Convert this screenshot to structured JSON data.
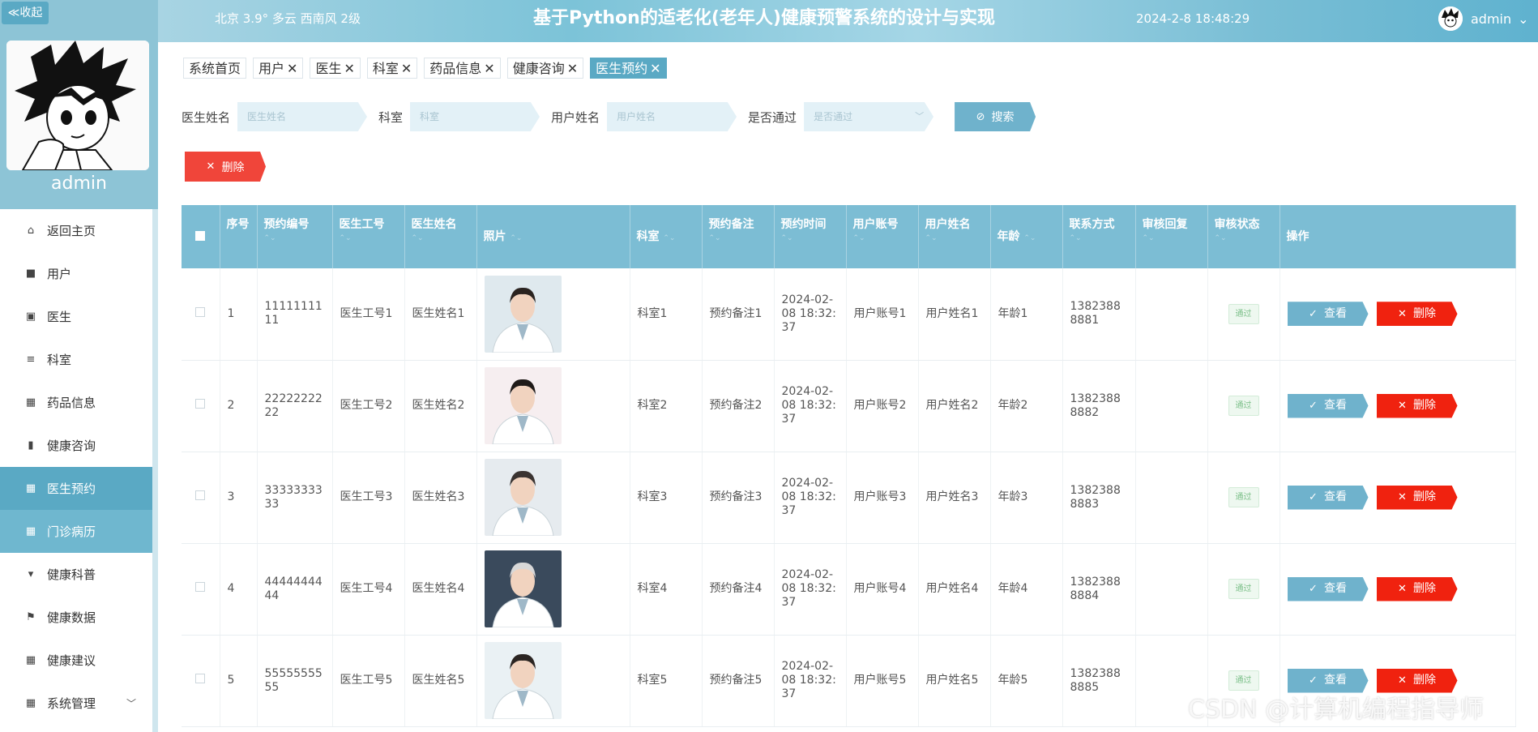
{
  "sidebar": {
    "collapse_label": "≪收起",
    "username": "admin",
    "menu": [
      {
        "label": "返回主页",
        "icon": "home-icon",
        "glyph": "⌂"
      },
      {
        "label": "用户",
        "icon": "user-icon",
        "glyph": "■"
      },
      {
        "label": "医生",
        "icon": "doctor-icon",
        "glyph": "▣"
      },
      {
        "label": "科室",
        "icon": "list-icon",
        "glyph": "≡"
      },
      {
        "label": "药品信息",
        "icon": "grid-icon",
        "glyph": "▦"
      },
      {
        "label": "健康咨询",
        "icon": "chart-icon",
        "glyph": "▮"
      },
      {
        "label": "医生预约",
        "icon": "grid-icon",
        "glyph": "▦"
      },
      {
        "label": "门诊病历",
        "icon": "grid-icon",
        "glyph": "▦"
      },
      {
        "label": "健康科普",
        "icon": "flag-icon",
        "glyph": "▾"
      },
      {
        "label": "健康数据",
        "icon": "flag-icon",
        "glyph": "⚑"
      },
      {
        "label": "健康建议",
        "icon": "grid-icon",
        "glyph": "▦"
      },
      {
        "label": "系统管理",
        "icon": "grid-icon",
        "glyph": "▦"
      }
    ]
  },
  "header": {
    "weather": "北京  3.9°  多云  西南风  2级",
    "title": "基于Python的适老化(老年人)健康预警系统的设计与实现",
    "datetime": "2024-2-8 18:48:29",
    "user": "admin",
    "user_chevron": "⌄"
  },
  "tabs": [
    {
      "label": "系统首页",
      "closable": false
    },
    {
      "label": "用户",
      "closable": true
    },
    {
      "label": "医生",
      "closable": true
    },
    {
      "label": "科室",
      "closable": true
    },
    {
      "label": "药品信息",
      "closable": true
    },
    {
      "label": "健康咨询",
      "closable": true
    },
    {
      "label": "医生预约",
      "closable": true,
      "active": true
    }
  ],
  "search": {
    "doctor_name_label": "医生姓名",
    "doctor_name_placeholder": "医生姓名",
    "dept_label": "科室",
    "dept_placeholder": "科室",
    "user_name_label": "用户姓名",
    "user_name_placeholder": "用户姓名",
    "passed_label": "是否通过",
    "passed_placeholder": "是否通过",
    "search_label": "搜索",
    "search_glyph": "⊘"
  },
  "delete_label": "删除",
  "delete_glyph": "✕",
  "table": {
    "headers": [
      "序号",
      "预约编号",
      "医生工号",
      "医生姓名",
      "照片",
      "科室",
      "预约备注",
      "预约时间",
      "用户账号",
      "用户姓名",
      "年龄",
      "联系方式",
      "审核回复",
      "审核状态",
      "操作"
    ],
    "sort_glyph": "⌃⌄",
    "rows": [
      {
        "idx": "1",
        "code": "1111111111",
        "doc_no": "医生工号1",
        "doc_name": "医生姓名1",
        "dept": "科室1",
        "note": "预约备注1",
        "time": "2024-02-08 18:32:37",
        "account": "用户账号1",
        "uname": "用户姓名1",
        "age": "年龄1",
        "phone": "13823888881",
        "reply": "",
        "status": "通过"
      },
      {
        "idx": "2",
        "code": "2222222222",
        "doc_no": "医生工号2",
        "doc_name": "医生姓名2",
        "dept": "科室2",
        "note": "预约备注2",
        "time": "2024-02-08 18:32:37",
        "account": "用户账号2",
        "uname": "用户姓名2",
        "age": "年龄2",
        "phone": "13823888882",
        "reply": "",
        "status": "通过"
      },
      {
        "idx": "3",
        "code": "3333333333",
        "doc_no": "医生工号3",
        "doc_name": "医生姓名3",
        "dept": "科室3",
        "note": "预约备注3",
        "time": "2024-02-08 18:32:37",
        "account": "用户账号3",
        "uname": "用户姓名3",
        "age": "年龄3",
        "phone": "13823888883",
        "reply": "",
        "status": "通过"
      },
      {
        "idx": "4",
        "code": "4444444444",
        "doc_no": "医生工号4",
        "doc_name": "医生姓名4",
        "dept": "科室4",
        "note": "预约备注4",
        "time": "2024-02-08 18:32:37",
        "account": "用户账号4",
        "uname": "用户姓名4",
        "age": "年龄4",
        "phone": "13823888884",
        "reply": "",
        "status": "通过"
      },
      {
        "idx": "5",
        "code": "5555555555",
        "doc_no": "医生工号5",
        "doc_name": "医生姓名5",
        "dept": "科室5",
        "note": "预约备注5",
        "time": "2024-02-08 18:32:37",
        "account": "用户账号5",
        "uname": "用户姓名5",
        "age": "年龄5",
        "phone": "13823888885",
        "reply": "",
        "status": "通过"
      }
    ],
    "view_label": "查看",
    "view_glyph": "✓",
    "del_label": "删除",
    "del_glyph": "✕"
  },
  "watermark": "CSDN @计算机编程指导师",
  "colors": {
    "accent": "#5aa9c4",
    "header": "#7cc3d8",
    "danger": "#f0220f",
    "table_head": "#7cbdd4"
  }
}
